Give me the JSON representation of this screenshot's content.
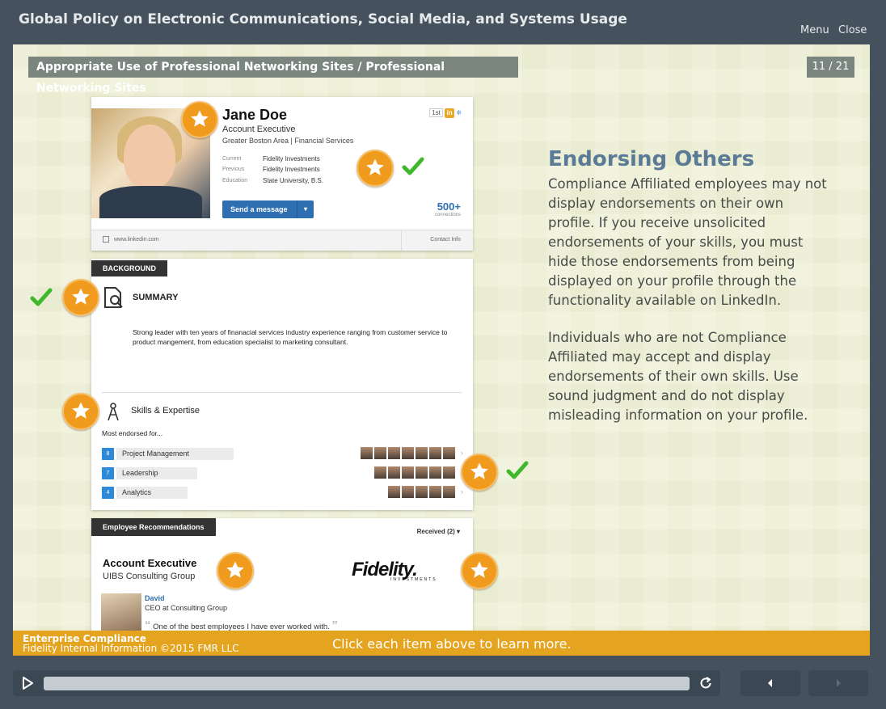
{
  "header": {
    "course_title": "Global Policy on Electronic Communications, Social Media, and Systems Usage",
    "menu_label": "Menu",
    "close_label": "Close"
  },
  "slide": {
    "breadcrumb": "Appropriate Use of Professional Networking Sites  /  Professional Networking Sites",
    "page_counter": "11 / 21",
    "profile": {
      "name": "Jane Doe",
      "role": "Account Executive",
      "location": "Greater Boston Area  |  Financial Services",
      "degree": "1st",
      "in_logo": "in",
      "meta": [
        {
          "label": "Current",
          "value": "Fidelity Investments"
        },
        {
          "label": "Previous",
          "value": "Fidelity Investments"
        },
        {
          "label": "Education",
          "value": "State University, B.S."
        }
      ],
      "send_message": "Send a message",
      "send_caret": "▾",
      "connections_count": "500+",
      "connections_label": "connections",
      "site_url": "www.linkedin.com",
      "contact_info": "Contact Info"
    },
    "background": {
      "tag": "BACKGROUND",
      "summary_title": "SUMMARY",
      "summary_text": "Strong leader with ten years of finanacial services industry experience ranging from customer service to product mangement, from education specialist to marketing consultant.",
      "skills_title": "Skills & Expertise",
      "most_endorsed": "Most endorsed for...",
      "skills": [
        {
          "count": "8",
          "name": "Project Management"
        },
        {
          "count": "7",
          "name": "Leadership"
        },
        {
          "count": "4",
          "name": "Analytics"
        }
      ]
    },
    "recommendations": {
      "tag": "Employee Recommendations",
      "received": "Received (2) ▾",
      "title": "Account Executive",
      "org": "UIBS Consulting Group",
      "logo_text": "Fidelity.",
      "logo_sub": "INVESTMENTS",
      "recommender_name": "David",
      "recommender_role": "CEO at Consulting Group",
      "quote": "One of the best employees I have ever worked with."
    },
    "content": {
      "heading": "Endorsing Others",
      "paragraph1": "Compliance Affiliated employees may not display endorsements on their own profile. If you receive unsolicited endorsements of your skills, you must hide those endorsements from being displayed on your profile through the functionality available on LinkedIn.",
      "paragraph2": "Individuals who are not Compliance Affiliated may accept and display endorsements of their own skills.  Use sound judgment and do not display misleading information on your profile."
    }
  },
  "footer": {
    "org": "Enterprise Compliance",
    "copyright": "Fidelity Internal Information ©2015 FMR LLC",
    "instruction": "Click each item above to learn more."
  },
  "player": {
    "progress": 1.0
  },
  "colors": {
    "accent_orange": "#f09a1e",
    "check_green": "#3fb82c",
    "heading_blue": "#5b7a95",
    "footer_gold": "#e5a41f"
  }
}
